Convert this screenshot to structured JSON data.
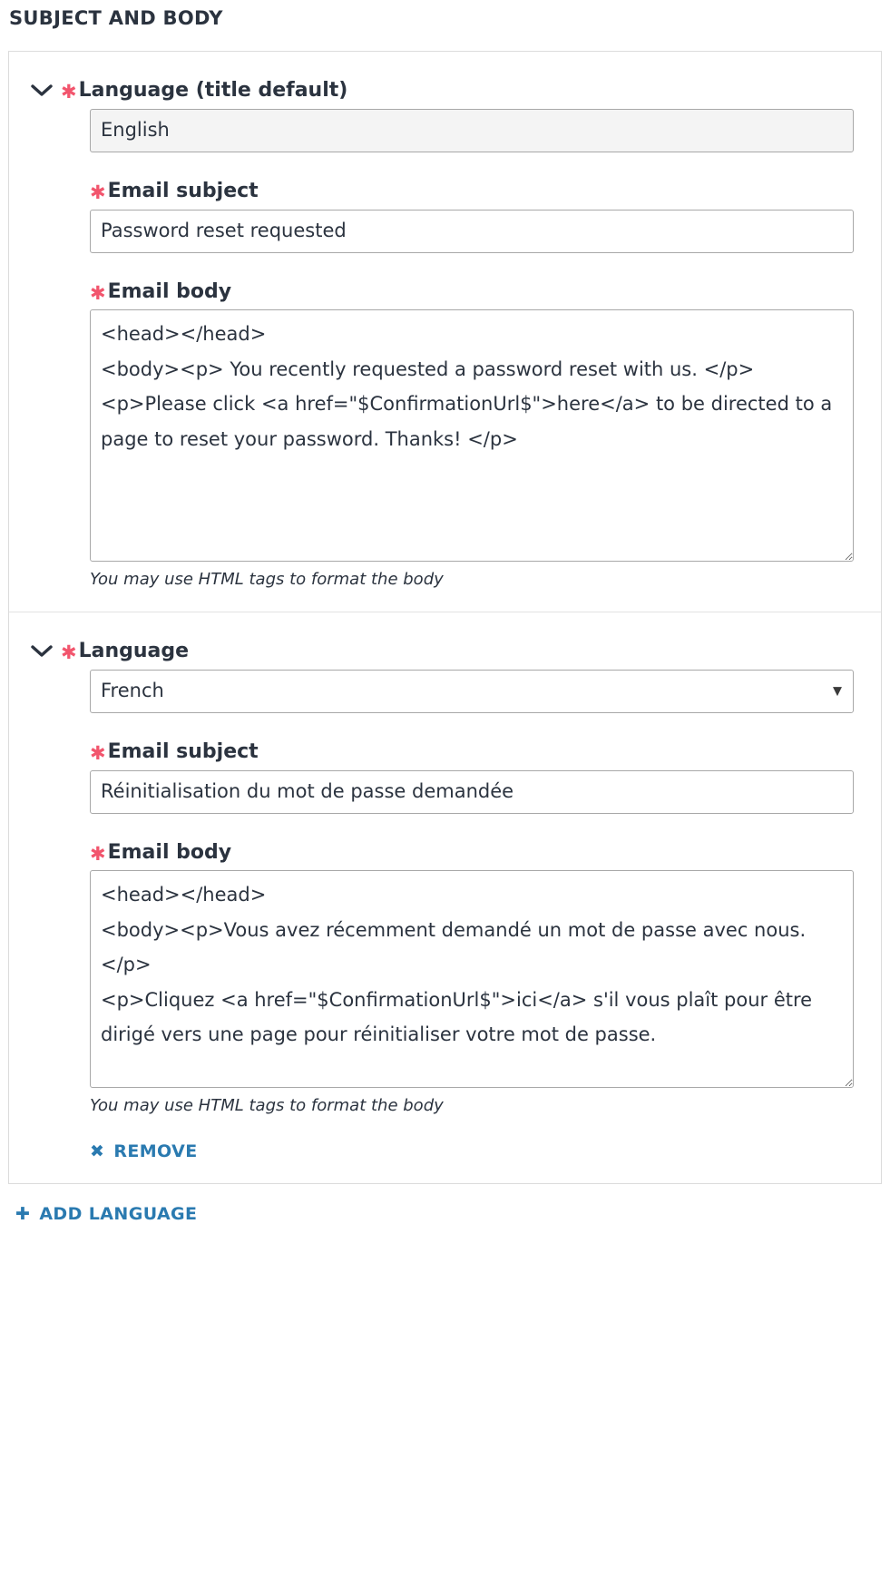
{
  "section": {
    "title": "SUBJECT AND BODY"
  },
  "colors": {
    "required_asterisk": "#f2556d",
    "link": "#2a7ab0",
    "text": "#2b333f",
    "panel_border": "#dcdcdc",
    "input_border": "#a8a8a8",
    "readonly_bg": "#f4f4f4"
  },
  "icons": {
    "chevron": "chevron-down-icon",
    "remove": "✖",
    "add": "✚",
    "select_caret": "▼"
  },
  "blocks": [
    {
      "language_label": "Language (title default)",
      "required_mark": "✱",
      "language_value": "English",
      "language_control": "readonly-text",
      "subject_label": "Email subject",
      "subject_value": "Password reset requested",
      "subject_placeholder": "",
      "body_label": "Email body",
      "body_value": "<head></head>\n<body><p> You recently requested a password reset with us. </p>\n<p>Please click <a href=\"$ConfirmationUrl$\">here</a> to be directed to a page to reset your password. Thanks! </p>",
      "body_placeholder": "",
      "helper_text": "You may use HTML tags to format the body",
      "remove_label": null
    },
    {
      "language_label": "Language",
      "required_mark": "✱",
      "language_value": "French",
      "language_control": "select",
      "language_options": [
        "French"
      ],
      "subject_label": "Email subject",
      "subject_value": "Réinitialisation du mot de passe demandée",
      "subject_placeholder": "",
      "body_label": "Email body",
      "body_value": "<head></head>\n<body><p>Vous avez récemment demandé un mot de passe avec nous. </p>\n<p>Cliquez <a href=\"$ConfirmationUrl$\">ici</a> s'il vous plaît pour être dirigé vers une page pour réinitialiser votre mot de passe.",
      "body_placeholder": "",
      "helper_text": "You may use HTML tags to format the body",
      "remove_label": "REMOVE"
    }
  ],
  "footer": {
    "add_language_label": "ADD LANGUAGE"
  }
}
